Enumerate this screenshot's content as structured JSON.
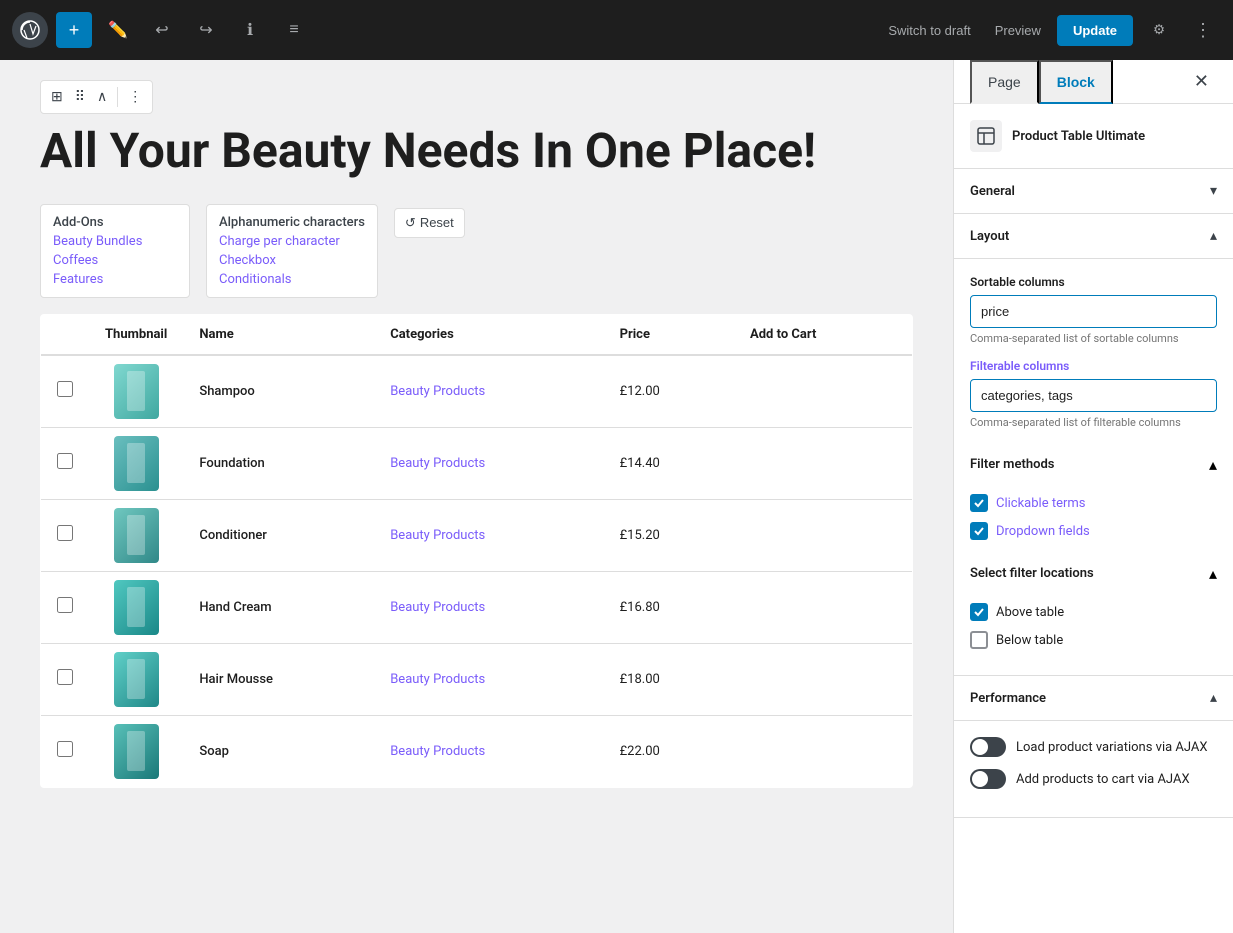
{
  "toolbar": {
    "add_label": "+",
    "switch_draft_label": "Switch to draft",
    "preview_label": "Preview",
    "update_label": "Update"
  },
  "page_title": "All Your Beauty Needs In One Place!",
  "filter_columns": {
    "col1": {
      "items": [
        "Add-Ons",
        "Beauty Bundles",
        "Coffees",
        "Features"
      ]
    },
    "col2": {
      "items": [
        "Alphanumeric characters",
        "Charge per character",
        "Checkbox",
        "Conditionals"
      ]
    }
  },
  "reset_label": "Reset",
  "table": {
    "headers": [
      "",
      "Thumbnail",
      "Name",
      "Categories",
      "Price",
      "Add to Cart"
    ],
    "rows": [
      {
        "name": "Shampoo",
        "category": "Beauty Products",
        "price": "£12.00"
      },
      {
        "name": "Foundation",
        "category": "Beauty Products",
        "price": "£14.40"
      },
      {
        "name": "Conditioner",
        "category": "Beauty Products",
        "price": "£15.20"
      },
      {
        "name": "Hand Cream",
        "category": "Beauty Products",
        "price": "£16.80"
      },
      {
        "name": "Hair Mousse",
        "category": "Beauty Products",
        "price": "£18.00"
      },
      {
        "name": "Soap",
        "category": "Beauty Products",
        "price": "£22.00"
      }
    ]
  },
  "sidebar": {
    "tab_page": "Page",
    "tab_block": "Block",
    "block_title": "Product Table Ultimate",
    "sections": {
      "general": {
        "title": "General",
        "collapsed": true
      },
      "layout": {
        "title": "Layout",
        "collapsed": false,
        "sortable_columns_label": "Sortable columns",
        "sortable_columns_value": "price",
        "sortable_columns_hint": "Comma-separated list of sortable columns",
        "filterable_columns_label": "Filterable columns",
        "filterable_columns_value": "categories, tags",
        "filterable_columns_hint": "Comma-separated list of filterable columns",
        "filter_methods": {
          "title": "Filter methods",
          "clickable_terms": "Clickable terms",
          "clickable_terms_checked": true,
          "dropdown_fields": "Dropdown fields",
          "dropdown_fields_checked": true
        },
        "filter_locations": {
          "title": "Select filter locations",
          "above_table": "Above table",
          "above_table_checked": true,
          "below_table": "Below table",
          "below_table_checked": false
        }
      },
      "performance": {
        "title": "Performance",
        "collapsed": false,
        "load_variations_label": "Load product variations via AJAX",
        "add_to_cart_label": "Add products to cart via AJAX"
      }
    }
  }
}
